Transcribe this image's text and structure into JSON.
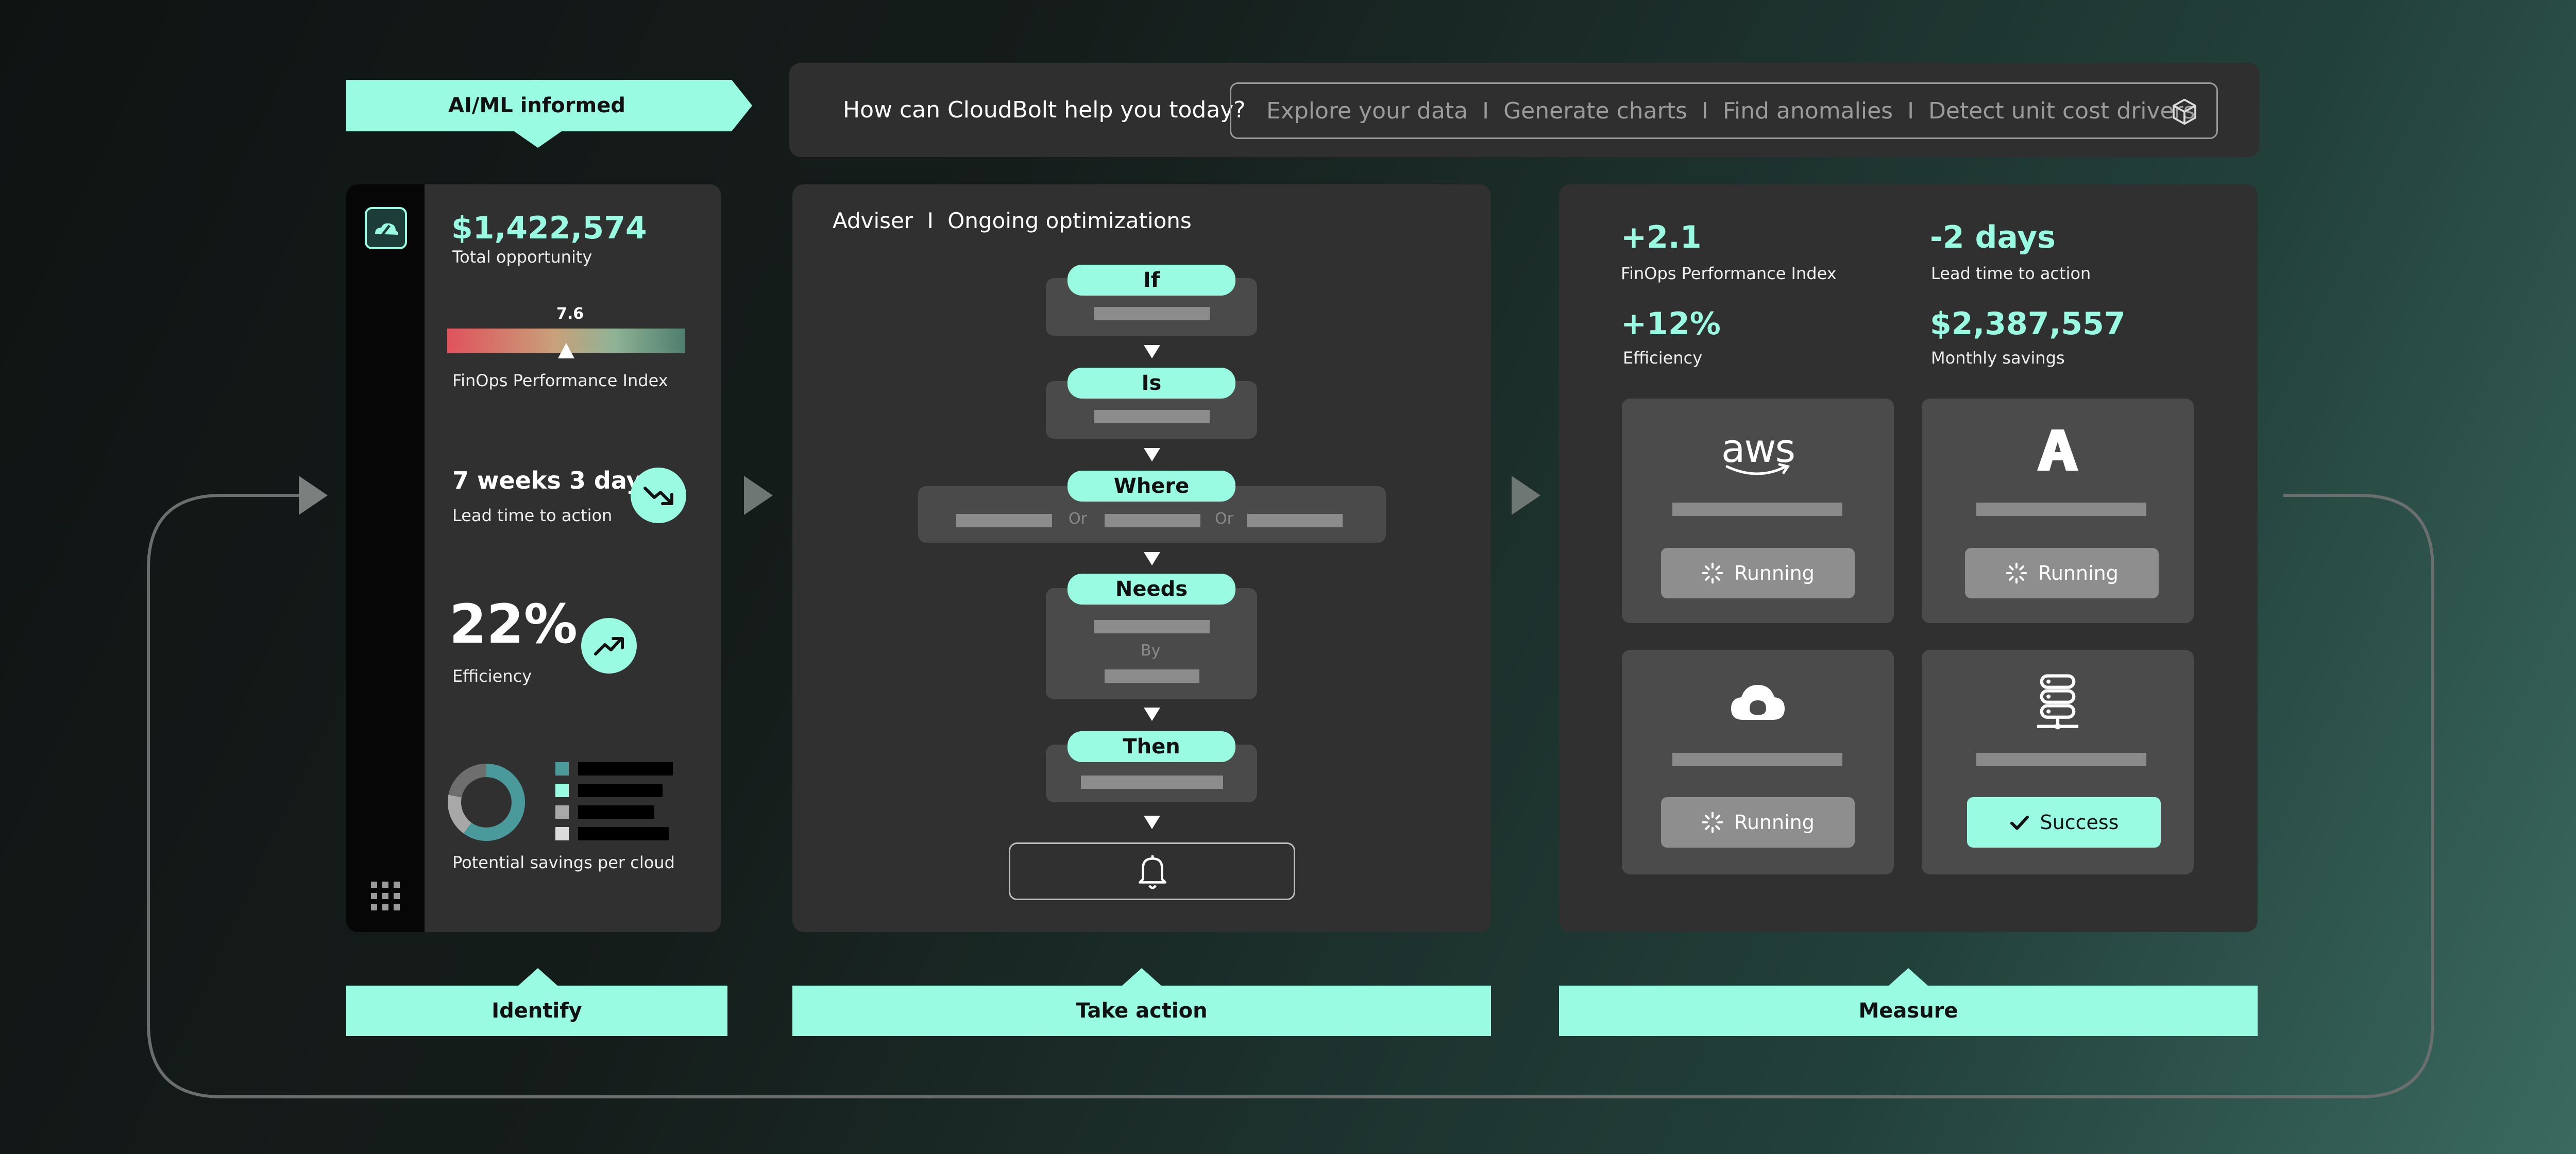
{
  "labels": {
    "ai_ml": "AI/ML informed",
    "identify": "Identify",
    "take_action": "Take action",
    "measure": "Measure"
  },
  "search": {
    "question": "How can CloudBolt help you today?",
    "suggestions": [
      "Explore your data",
      "Generate charts",
      "Find anomalies",
      "Detect unit cost drivers"
    ],
    "separator": "I"
  },
  "identify": {
    "total_value": "$1,422,574",
    "total_label": "Total opportunity",
    "index_value": "7.6",
    "index_fraction": 0.5,
    "index_label": "FinOps Performance Index",
    "lead_value": "7 weeks 3 days",
    "lead_label": "Lead time to action",
    "eff_value": "22%",
    "eff_label": "Efficiency",
    "savings_label": "Potential savings per cloud"
  },
  "action": {
    "title": "Adviser",
    "title_sep": "I",
    "subtitle": "Ongoing optimizations",
    "steps": [
      "If",
      "Is",
      "Where",
      "Needs",
      "Then"
    ],
    "or_label": "Or",
    "by_label": "By"
  },
  "measure": {
    "m1_value": "+2.1",
    "m1_label": "FinOps Performance Index",
    "m2_value": "-2 days",
    "m2_label": "Lead time to action",
    "m3_value": "+12%",
    "m3_label": "Efficiency",
    "m4_value": "$2,387,557",
    "m4_label": "Monthly savings",
    "aws_text": "aws",
    "status_running": "Running",
    "status_success": "Success"
  },
  "colors": {
    "accent": "#98fbe2",
    "panel": "#303030",
    "card": "#4b4b4b",
    "bar": "#8a8a8a"
  }
}
